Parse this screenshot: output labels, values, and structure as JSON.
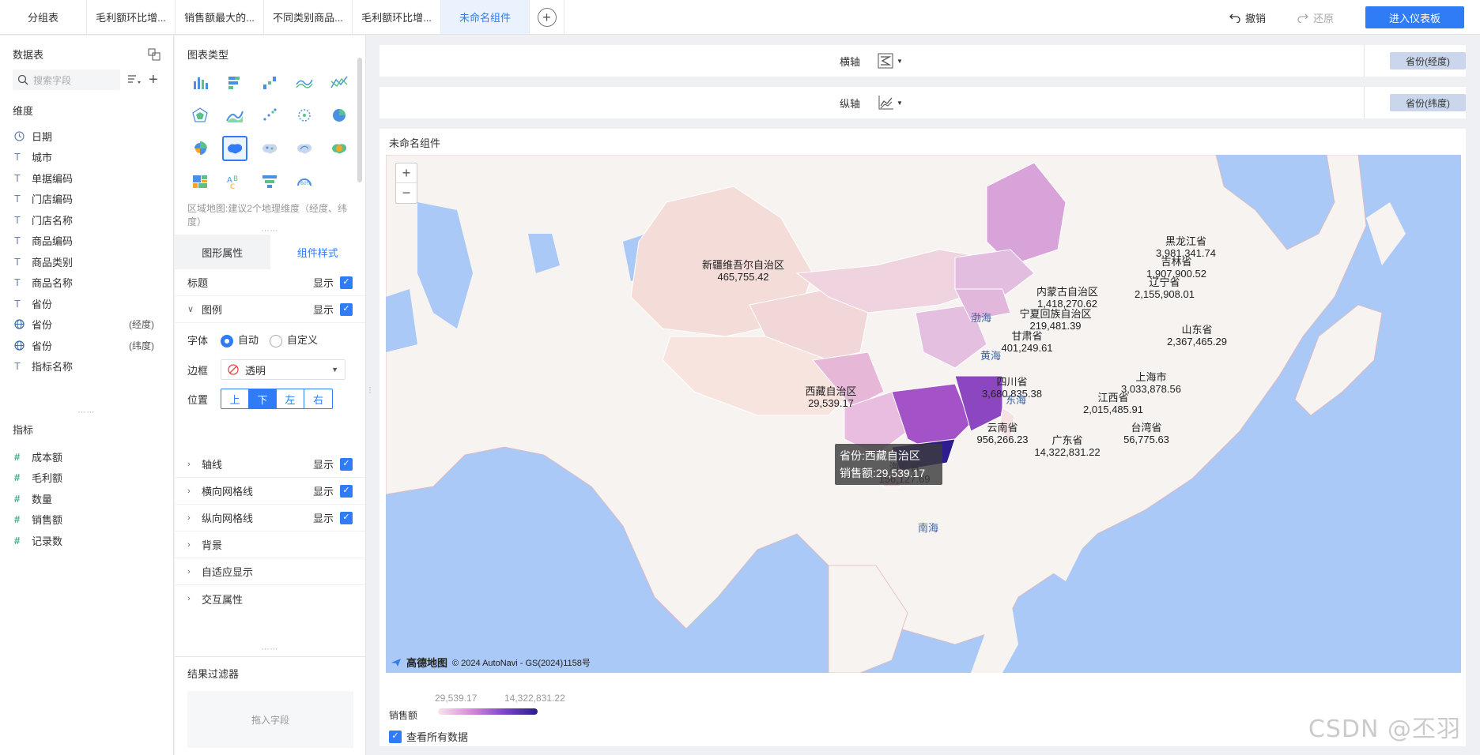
{
  "tabs": [
    "分组表",
    "毛利额环比增...",
    "销售额最大的...",
    "不同类别商品...",
    "毛利额环比增...",
    "未命名组件"
  ],
  "active_tab": 5,
  "actions": {
    "undo": "撤销",
    "redo": "还原",
    "enter": "进入仪表板"
  },
  "data_panel": {
    "title": "数据表",
    "search_placeholder": "搜索字段",
    "dimensions_title": "维度",
    "dimensions": [
      {
        "name": "日期",
        "icon": "clock-icon",
        "suffix": ""
      },
      {
        "name": "城市",
        "icon": "text-type-icon",
        "suffix": ""
      },
      {
        "name": "单据编码",
        "icon": "text-type-icon",
        "suffix": ""
      },
      {
        "name": "门店编码",
        "icon": "text-type-icon",
        "suffix": ""
      },
      {
        "name": "门店名称",
        "icon": "text-type-icon",
        "suffix": ""
      },
      {
        "name": "商品编码",
        "icon": "text-type-icon",
        "suffix": ""
      },
      {
        "name": "商品类别",
        "icon": "text-type-icon",
        "suffix": ""
      },
      {
        "name": "商品名称",
        "icon": "text-type-icon",
        "suffix": ""
      },
      {
        "name": "省份",
        "icon": "text-type-icon",
        "suffix": ""
      },
      {
        "name": "省份",
        "icon": "globe-icon",
        "suffix": "(经度)"
      },
      {
        "name": "省份",
        "icon": "globe-icon",
        "suffix": "(纬度)"
      },
      {
        "name": "指标名称",
        "icon": "text-type-icon",
        "suffix": ""
      }
    ],
    "measures_title": "指标",
    "measures": [
      "成本额",
      "毛利额",
      "数量",
      "销售额",
      "记录数"
    ]
  },
  "config_panel": {
    "chart_type_title": "图表类型",
    "hint": "区域地图:建议2个地理维度（经度、纬度）",
    "tab_shape": "图形属性",
    "tab_style": "组件样式",
    "title_label": "标题",
    "show_label": "显示",
    "legend_label": "图例",
    "font_label": "字体",
    "font_auto": "自动",
    "font_custom": "自定义",
    "border_label": "边框",
    "border_value": "透明",
    "position_label": "位置",
    "positions": [
      "上",
      "下",
      "左",
      "右"
    ],
    "axis_line": "轴线",
    "h_grid": "横向网格线",
    "v_grid": "纵向网格线",
    "background": "背景",
    "adaptive": "自适应显示",
    "interaction": "交互属性",
    "filter_title": "结果过滤器",
    "drop_hint": "拖入字段"
  },
  "axes": {
    "x_label": "横轴",
    "y_label": "纵轴",
    "x_field": "省份(经度)",
    "y_field": "省份(纬度)"
  },
  "card": {
    "title": "未命名组件",
    "copyright": "© 2024 AutoNavi - GS(2024)1158号",
    "map_logo": "高德地图",
    "tooltip_line1": "省份:西藏自治区",
    "tooltip_line2": "销售额:29,539.17",
    "legend_name": "销售额",
    "legend_min": "29,539.17",
    "legend_max": "14,322,831.22",
    "view_all": "查看所有数据"
  },
  "provinces": [
    {
      "name": "新疆维吾尔自治区",
      "value": "465,755.42"
    },
    {
      "name": "黑龙江省",
      "value": "3,981,341.74"
    },
    {
      "name": "吉林省",
      "value": "1,907,900.52"
    },
    {
      "name": "辽宁省",
      "value": "2,155,908.01"
    },
    {
      "name": "内蒙古自治区",
      "value": "1,418,270.62"
    },
    {
      "name": "宁夏回族自治区",
      "value": "219,481.39"
    },
    {
      "name": "甘肃省",
      "value": "401,249.61"
    },
    {
      "name": "山东省",
      "value": "2,367,465.29"
    },
    {
      "name": "上海市",
      "value": "3,033,878.56"
    },
    {
      "name": "四川省",
      "value": "3,680,835.38"
    },
    {
      "name": "西藏自治区",
      "value": "29,539.17"
    },
    {
      "name": "江西省",
      "value": "2,015,485.91"
    },
    {
      "name": "台湾省",
      "value": "56,775.63"
    },
    {
      "name": "云南省",
      "value": "956,266.23"
    },
    {
      "name": "广东省",
      "value": "14,322,831.22"
    },
    {
      "name": "海南省",
      "value": "156,127.69"
    }
  ],
  "seas": [
    "渤海",
    "黄海",
    "东海",
    "南海"
  ],
  "watermark": "CSDN @丕羽",
  "colors": {
    "accent": "#2f7cf6",
    "sea": "#aac9f7",
    "land": "#f5f3f1"
  }
}
